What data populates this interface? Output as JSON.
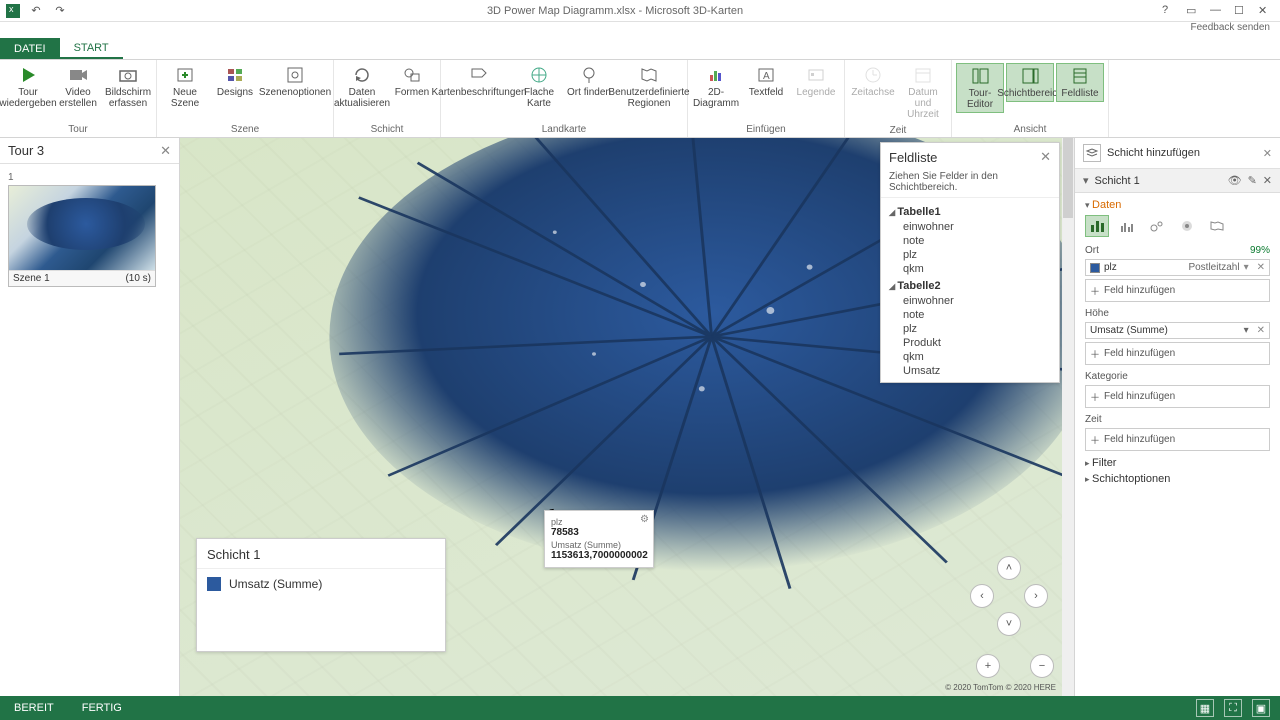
{
  "title": "3D Power Map Diagramm.xlsx - Microsoft 3D-Karten",
  "feedback": "Feedback senden",
  "tabs": {
    "file": "DATEI",
    "start": "START"
  },
  "ribbon": {
    "tour": {
      "play": "Tour wiedergeben",
      "video": "Video erstellen",
      "capture": "Bildschirm erfassen",
      "group": "Tour"
    },
    "scene": {
      "new": "Neue Szene",
      "designs": "Designs",
      "opts": "Szenenoptionen",
      "group": "Szene"
    },
    "layer": {
      "refresh": "Daten aktualisieren",
      "shapes": "Formen",
      "group": "Schicht"
    },
    "map": {
      "labels": "Kartenbeschriftungen",
      "flat": "Flache Karte",
      "find": "Ort finden",
      "regions": "Benutzerdefinierte Regionen",
      "group": "Landkarte"
    },
    "insert": {
      "chart2d": "2D-Diagramm",
      "textfield": "Textfeld",
      "legend": "Legende",
      "group": "Einfügen"
    },
    "time": {
      "timeline": "Zeitachse",
      "datetime": "Datum und Uhrzeit",
      "group": "Zeit"
    },
    "view": {
      "toured": "Tour-Editor",
      "layerpane": "Schichtbereich",
      "fieldlist": "Feldliste",
      "group": "Ansicht"
    }
  },
  "tourpane": {
    "title": "Tour 3",
    "sceneNum": "1",
    "sceneName": "Szene 1",
    "sceneDur": "(10 s)"
  },
  "legend": {
    "title": "Schicht 1",
    "series": "Umsatz (Summe)"
  },
  "tooltip": {
    "field1_label": "plz",
    "field1_value": "78583",
    "field2_label": "Umsatz (Summe)",
    "field2_value": "1153613,7000000002"
  },
  "credits": "© 2020 TomTom © 2020 HERE",
  "fieldlist": {
    "title": "Feldliste",
    "hint": "Ziehen Sie Felder in den Schichtbereich.",
    "tables": [
      {
        "name": "Tabelle1",
        "fields": [
          "einwohner",
          "note",
          "plz",
          "qkm"
        ]
      },
      {
        "name": "Tabelle2",
        "fields": [
          "einwohner",
          "note",
          "plz",
          "Produkt",
          "qkm",
          "Umsatz"
        ]
      }
    ]
  },
  "layerpanel": {
    "add": "Schicht hinzufügen",
    "layername": "Schicht 1",
    "daten": "Daten",
    "ort": {
      "label": "Ort",
      "pct": "99%",
      "field": "plz",
      "type": "Postleitzahl"
    },
    "hoehe": {
      "label": "Höhe",
      "field": "Umsatz (Summe)"
    },
    "kategorie": {
      "label": "Kategorie"
    },
    "zeit": {
      "label": "Zeit"
    },
    "addfield": "Feld hinzufügen",
    "filter": "Filter",
    "opts": "Schichtoptionen"
  },
  "status": {
    "ready": "BEREIT",
    "done": "FERTIG"
  }
}
